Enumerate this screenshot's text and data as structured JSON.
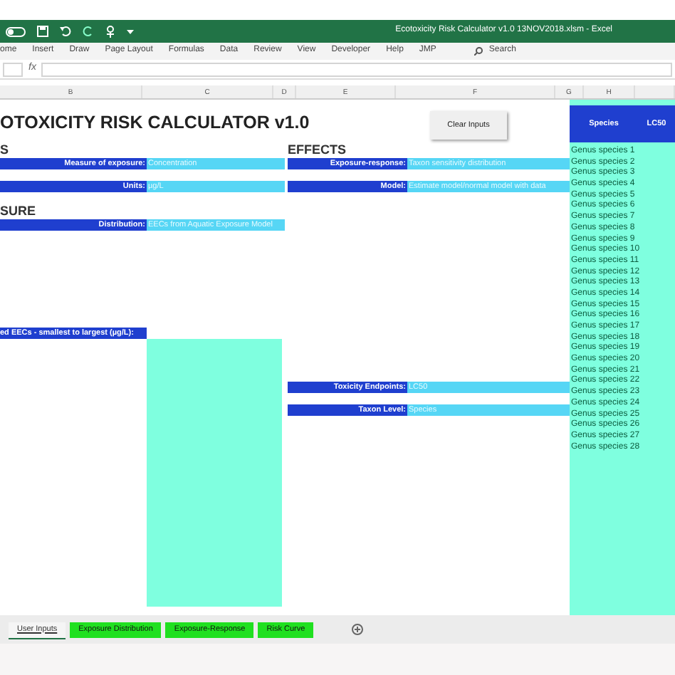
{
  "title_bar": {
    "title": "Ecotoxicity Risk Calculator v1.0 13NOV2018.xlsm  -  Excel"
  },
  "ribbon_tabs": [
    "ome",
    "Insert",
    "Draw",
    "Page Layout",
    "Formulas",
    "Data",
    "Review",
    "View",
    "Developer",
    "Help",
    "JMP"
  ],
  "search": {
    "placeholder": "Search"
  },
  "formula_bar": {
    "function_label": "fx"
  },
  "column_headers": [
    "B",
    "C",
    "D",
    "E",
    "F",
    "G",
    "H"
  ],
  "sheet": {
    "title": "OTOXICITY RISK CALCULATOR v1.0",
    "clear_button": "Clear Inputs",
    "left_sections": [
      {
        "heading": "S",
        "fields": [
          {
            "label": "Measure of exposure:",
            "value": "Concentration"
          },
          {
            "label": "Units:",
            "value": "µg/L"
          }
        ]
      },
      {
        "heading": "SURE",
        "fields": [
          {
            "label": "Distribution:",
            "value": "EECs from Aquatic Exposure Model"
          }
        ]
      }
    ],
    "eec_label": "ed EECs - smallest to largest (µg/L):",
    "effects": {
      "heading": "EFFECTS",
      "fields": [
        {
          "label": "Exposure-response:",
          "value": "Taxon sensitivity distribution"
        },
        {
          "label": "Model:",
          "value": "Estimate model/normal model with data"
        }
      ],
      "lower_fields": [
        {
          "label": "Toxicity Endpoints:",
          "value": "LC50"
        },
        {
          "label": "Taxon Level:",
          "value": "Species"
        }
      ]
    }
  },
  "species_table": {
    "columns": [
      "Species",
      "LC50"
    ],
    "rows": [
      "Genus species 1",
      "Genus species 2",
      "Genus species 3",
      "Genus species 4",
      "Genus species 5",
      "Genus species 6",
      "Genus species 7",
      "Genus species 8",
      "Genus species 9",
      "Genus species 10",
      "Genus species 11",
      "Genus species 12",
      "Genus species 13",
      "Genus species 14",
      "Genus species 15",
      "Genus species 16",
      "Genus species 17",
      "Genus species 18",
      "Genus species 19",
      "Genus species 20",
      "Genus species 21",
      "Genus species 22",
      "Genus species 23",
      "Genus species 24",
      "Genus species 25",
      "Genus species 26",
      "Genus species 27",
      "Genus species 28"
    ]
  },
  "sheet_tabs": [
    {
      "label": "User Inputs",
      "selected": true
    },
    {
      "label": "Exposure Distribution",
      "selected": false
    },
    {
      "label": "Exposure-Response",
      "selected": false
    },
    {
      "label": "Risk Curve",
      "selected": false
    }
  ]
}
